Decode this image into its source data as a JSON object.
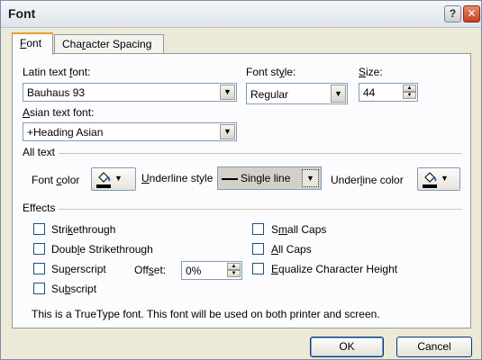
{
  "window": {
    "title": "Font",
    "help_glyph": "?",
    "close_glyph": "✕"
  },
  "tabs": [
    {
      "label_pre": "",
      "label_u": "F",
      "label_post": "ont"
    },
    {
      "label_pre": "Cha",
      "label_u": "r",
      "label_post": "acter Spacing"
    }
  ],
  "latin": {
    "label_pre": "Latin text ",
    "label_u": "f",
    "label_post": "ont:",
    "value": "Bauhaus 93"
  },
  "style": {
    "label_pre": "Font st",
    "label_u": "y",
    "label_post": "le:",
    "value": "Regular"
  },
  "size": {
    "label_pre": "",
    "label_u": "S",
    "label_post": "ize:",
    "value": "44"
  },
  "asian": {
    "label_pre": "",
    "label_u": "A",
    "label_post": "sian text font:",
    "value": "+Heading Asian"
  },
  "alltext": {
    "heading": "All text",
    "font_color_pre": "Font ",
    "font_color_u": "c",
    "font_color_post": "olor",
    "underline_style_pre": "",
    "underline_style_u": "U",
    "underline_style_post": "nderline style",
    "underline_value": "Single line",
    "underline_color_pre": "Under",
    "underline_color_u": "l",
    "underline_color_post": "ine color"
  },
  "effects": {
    "heading": "Effects",
    "strikethrough": {
      "pre": "Stri",
      "u": "k",
      "post": "ethrough",
      "checked": false
    },
    "double_strikethrough": {
      "pre": "Doub",
      "u": "l",
      "post": "e Strikethrough",
      "checked": false
    },
    "superscript": {
      "pre": "Su",
      "u": "p",
      "post": "erscript",
      "checked": false
    },
    "subscript": {
      "pre": "Su",
      "u": "b",
      "post": "script",
      "checked": false
    },
    "offset": {
      "pre": "Off",
      "u": "s",
      "post": "et:",
      "value": "0%"
    },
    "small_caps": {
      "pre": "S",
      "u": "m",
      "post": "all Caps",
      "checked": false
    },
    "all_caps": {
      "pre": "",
      "u": "A",
      "post": "ll Caps",
      "checked": false
    },
    "equalize": {
      "pre": "",
      "u": "E",
      "post": "qualize Character Height",
      "checked": false
    }
  },
  "footer_note": "This is a TrueType font. This font will be used on both printer and screen.",
  "buttons": {
    "ok": "OK",
    "cancel": "Cancel"
  },
  "colors": {
    "accent_tab": "#e5a228",
    "border": "#7f9db9",
    "face": "#ece9d8"
  },
  "icons": {
    "dropdown": "chevron-down-icon",
    "bucket": "paint-bucket-icon"
  }
}
